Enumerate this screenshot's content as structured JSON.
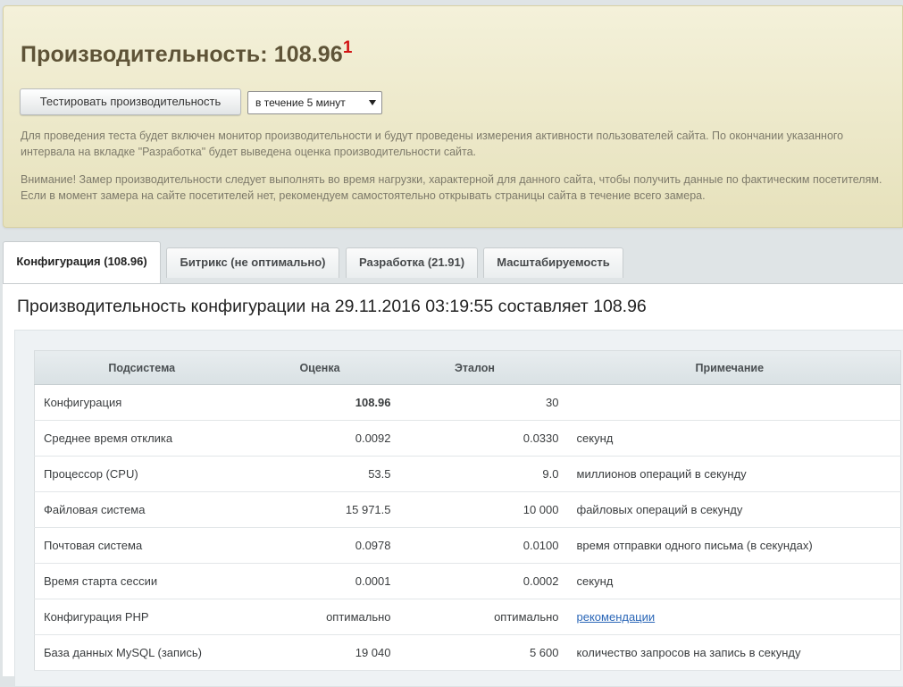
{
  "header": {
    "title": "Производительность: 108.96",
    "footnote": "1",
    "test_button": "Тестировать производительность",
    "duration_select": "в течение 5 минут",
    "info_text": "Для проведения теста будет включен монитор производительности и будут проведены измерения активности пользователей сайта. По окончании указанного интервала на вкладке \"Разработка\" будет выведена оценка производительности сайта.",
    "warning_text": "Внимание! Замер производительности следует выполнять во время нагрузки, характерной для данного сайта, чтобы получить данные по фактическим посетителям. Если в момент замера на сайте посетителей нет, рекомендуем самостоятельно открывать страницы сайта в течение всего замера."
  },
  "tabs": [
    {
      "label": "Конфигурация (108.96)",
      "active": true
    },
    {
      "label": "Битрикс (не оптимально)",
      "active": false
    },
    {
      "label": "Разработка (21.91)",
      "active": false
    },
    {
      "label": "Масштабируемость",
      "active": false
    }
  ],
  "content": {
    "title": "Производительность конфигурации на 29.11.2016 03:19:55 составляет 108.96",
    "table": {
      "headers": [
        "Подсистема",
        "Оценка",
        "Эталон",
        "Примечание"
      ],
      "rows": [
        {
          "subsystem": "Конфигурация",
          "score": "108.96",
          "reference": "30",
          "note": ""
        },
        {
          "subsystem": "Среднее время отклика",
          "score": "0.0092",
          "reference": "0.0330",
          "note": "секунд"
        },
        {
          "subsystem": "Процессор (CPU)",
          "score": "53.5",
          "reference": "9.0",
          "note": "миллионов операций в секунду"
        },
        {
          "subsystem": "Файловая система",
          "score": "15 971.5",
          "reference": "10 000",
          "note": "файловых операций в секунду"
        },
        {
          "subsystem": "Почтовая система",
          "score": "0.0978",
          "reference": "0.0100",
          "note": "время отправки одного письма (в секундах)"
        },
        {
          "subsystem": "Время старта сессии",
          "score": "0.0001",
          "reference": "0.0002",
          "note": "секунд"
        },
        {
          "subsystem": "Конфигурация PHP",
          "score": "оптимально",
          "reference": "оптимально",
          "note": "рекомендации"
        },
        {
          "subsystem": "База данных MySQL (запись)",
          "score": "19 040",
          "reference": "5 600",
          "note": "количество запросов на запись в секунду"
        }
      ]
    }
  }
}
